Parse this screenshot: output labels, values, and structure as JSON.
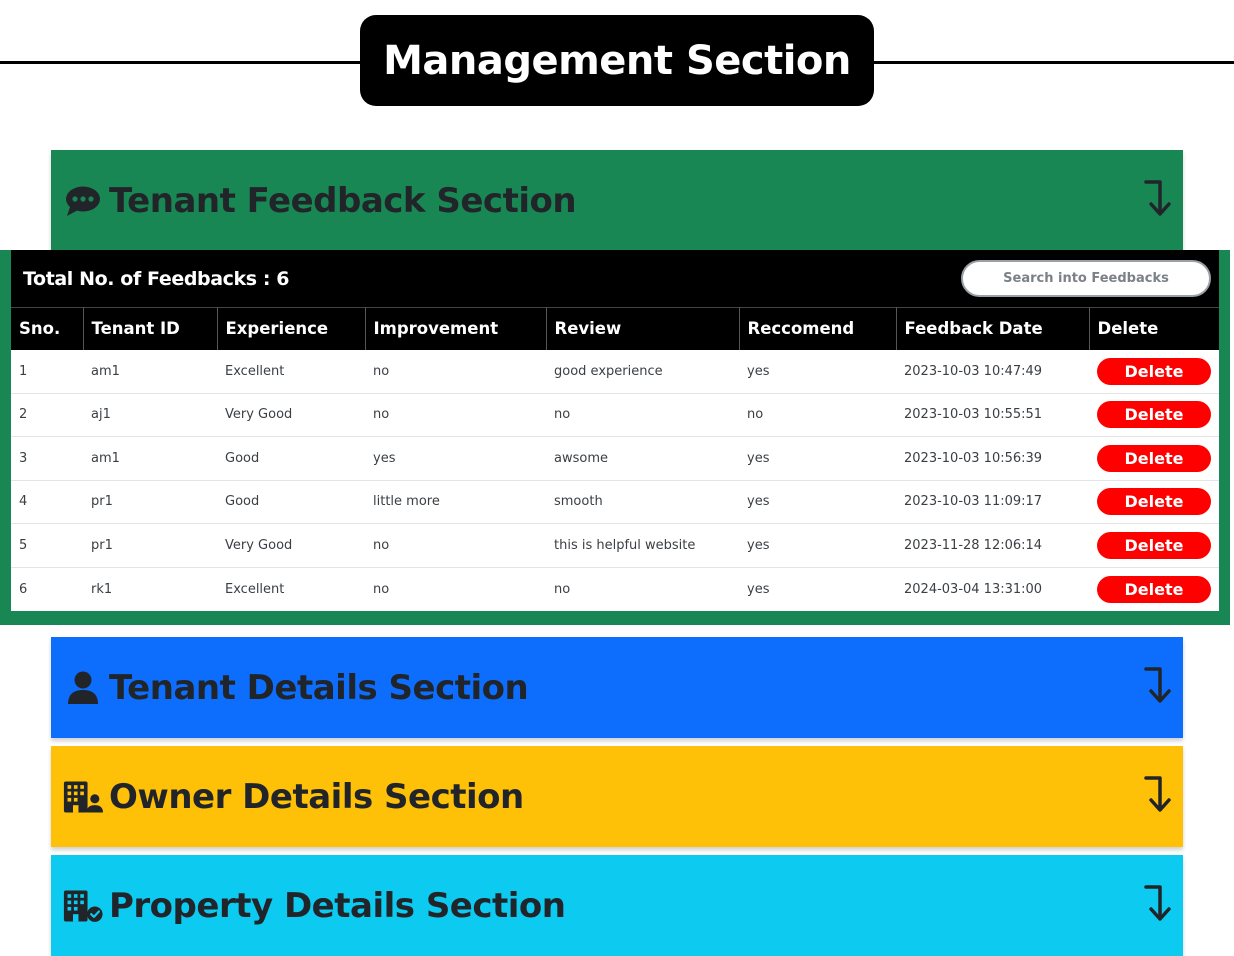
{
  "page_title": "Management Section",
  "sections": {
    "feedback": {
      "title": "Tenant Feedback Section",
      "icon": "comment-dots-icon"
    },
    "tenant": {
      "title": "Tenant Details Section",
      "icon": "user-icon"
    },
    "owner": {
      "title": "Owner Details Section",
      "icon": "building-user-icon"
    },
    "property": {
      "title": "Property Details Section",
      "icon": "building-check-icon"
    },
    "toggle_icon": "arrow-turn-down-icon"
  },
  "feedback": {
    "count_label": "Total No. of Feedbacks : 6",
    "search_placeholder": "Search into Feedbacks",
    "columns": [
      "Sno.",
      "Tenant ID",
      "Experience",
      "Improvement",
      "Review",
      "Reccomend",
      "Feedback Date",
      "Delete"
    ],
    "rows": [
      [
        "1",
        "am1",
        "Excellent",
        "no",
        "good experience",
        "yes",
        "2023-10-03 10:47:49",
        "Delete"
      ],
      [
        "2",
        "aj1",
        "Very Good",
        "no",
        "no",
        "no",
        "2023-10-03 10:55:51",
        "Delete"
      ],
      [
        "3",
        "am1",
        "Good",
        "yes",
        "awsome",
        "yes",
        "2023-10-03 10:56:39",
        "Delete"
      ],
      [
        "4",
        "pr1",
        "Good",
        "little more",
        "smooth",
        "yes",
        "2023-10-03 11:09:17",
        "Delete"
      ],
      [
        "5",
        "pr1",
        "Very Good",
        "no",
        "this is helpful website",
        "yes",
        "2023-11-28 12:06:14",
        "Delete"
      ],
      [
        "6",
        "rk1",
        "Excellent",
        "no",
        "no",
        "yes",
        "2024-03-04 13:31:00",
        "Delete"
      ]
    ]
  },
  "colors": {
    "feedback": "#198754",
    "tenant": "#0d6efd",
    "owner": "#ffc107",
    "property": "#0dcaf0",
    "delete": "#ff0000"
  }
}
